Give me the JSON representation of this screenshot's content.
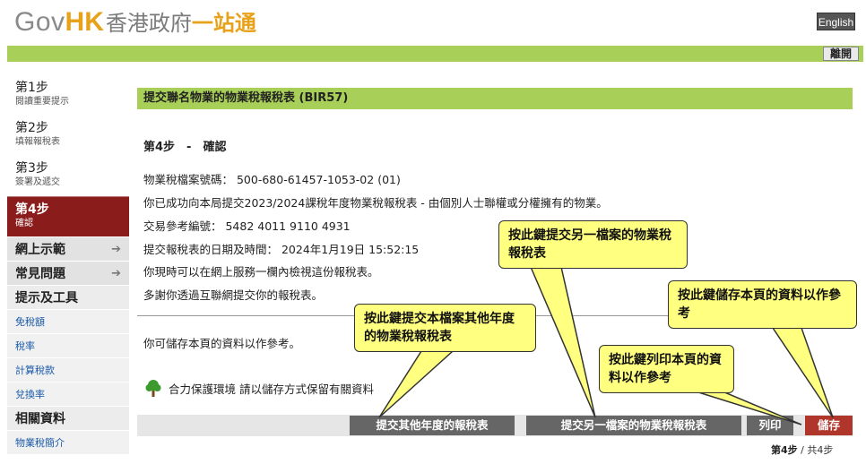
{
  "header": {
    "logo_gov": "Gov",
    "logo_hk": "HK",
    "logo_zh": "香港政府",
    "logo_zh_accent": "一站通",
    "english_label": "English",
    "logout_label": "離開"
  },
  "sidebar": {
    "steps": [
      {
        "title": "第1步",
        "subtitle": "閱讀重要提示"
      },
      {
        "title": "第2步",
        "subtitle": "填報報稅表"
      },
      {
        "title": "第3步",
        "subtitle": "簽署及遞交"
      },
      {
        "title": "第4步",
        "subtitle": "確認"
      }
    ],
    "nav": [
      {
        "label": "網上示範",
        "arrow": "➔"
      },
      {
        "label": "常見問題",
        "arrow": "➔"
      },
      {
        "label": "提示及工具"
      }
    ],
    "tools": [
      "免稅額",
      "稅率",
      "計算稅款",
      "兌換率"
    ],
    "related_label": "相關資料",
    "related_items": [
      "物業稅簡介"
    ]
  },
  "main": {
    "title": "提交聯名物業的物業稅報稅表 (BIR57)",
    "step_heading": "第4步　-　確認",
    "lines": [
      "物業稅檔案號碼：  500-680-61457-1053-02 (01)",
      "你已成功向本局提交2023/2024課稅年度物業稅報稅表 - 由個別人士聯權或分權擁有的物業。",
      "交易參考編號：  5482 4011 9110 4931",
      "提交報稅表的日期及時間：  2024年1月19日 15:52:15",
      "你現時可以在網上服務一欄內檢視這份報稅表。",
      "多謝你透過互聯網提交你的報稅表。"
    ],
    "save_note": "你可儲存本頁的資料以作參考。",
    "green_note": "合力保護環境 請以儲存方式保留有關資料"
  },
  "actions": {
    "other_year": "提交其他年度的報稅表",
    "another_file": "提交另一檔案的物業稅報稅表",
    "print": "列印",
    "save": "儲存"
  },
  "pager": {
    "current": "第4步",
    "separator": "/",
    "total": "共4步"
  },
  "callouts": {
    "other_year": "按此鍵提交本檔案其他年度的物業稅報稅表",
    "another_file": "按此鍵提交另一檔案的物業稅報稅表",
    "save": "按此鍵儲存本頁的資料以作參考",
    "print": "按此鍵列印本頁的資料以作參考"
  },
  "colors": {
    "accent_green": "#a8cf57",
    "active_step": "#8a1c1c",
    "callout_fill": "#ffff80",
    "save_button": "#b0362b"
  }
}
